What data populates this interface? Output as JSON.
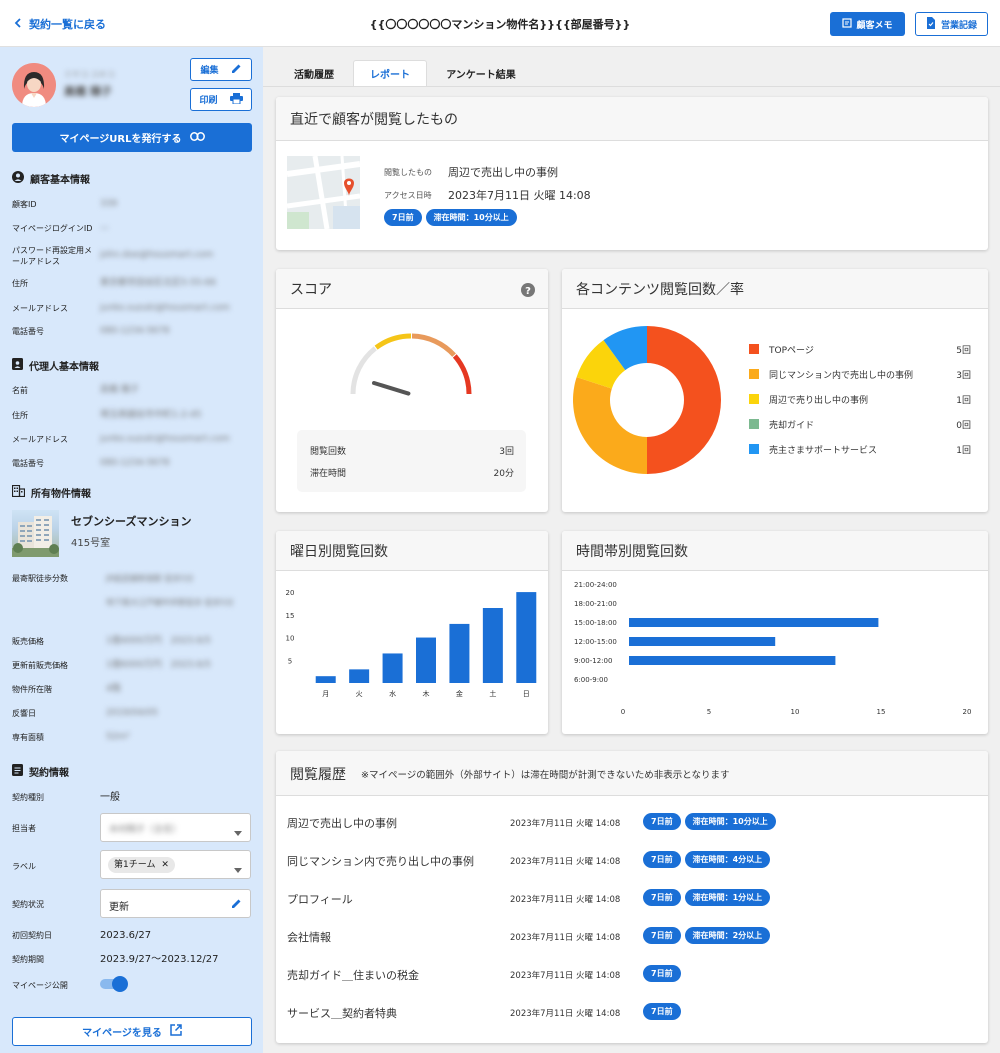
{
  "header": {
    "back_label": "契約一覧に戻る",
    "title": "{{〇〇〇〇〇〇マンション物件名}}{{部屋番号}}",
    "memo_label": "顧客メモ",
    "record_label": "営業記録"
  },
  "profile": {
    "name_kana": "ミヤコ ユキコ",
    "name": "高橋 陽子",
    "edit_label": "編集",
    "print_label": "印刷",
    "issue_url_label": "マイページURLを発行する"
  },
  "customer": {
    "title": "顧客基本情報",
    "rows": [
      {
        "label": "顧客ID",
        "value": "339"
      },
      {
        "label": "マイページログインID",
        "value": "—"
      },
      {
        "label": "パスワード再設定用メールアドレス",
        "value": "john.doe@housmart.com"
      },
      {
        "label": "住所",
        "value": "東京都世田谷区北区5-55-66"
      },
      {
        "label": "メールアドレス",
        "value": "junko.suzuki@housmart.com"
      },
      {
        "label": "電話番号",
        "value": "080-1234-5678"
      }
    ]
  },
  "agent": {
    "title": "代理人基本情報",
    "rows": [
      {
        "label": "名前",
        "value": "高橋 陽子"
      },
      {
        "label": "住所",
        "value": "埼玉県越谷市中町1-2-45"
      },
      {
        "label": "メールアドレス",
        "value": "junko.suzuki@housmart.com"
      },
      {
        "label": "電話番号",
        "value": "080-1234-5678"
      }
    ]
  },
  "property": {
    "title": "所有物件情報",
    "name": "セブンシーズマンション",
    "room": "415号室",
    "station_label": "最寄駅徒歩分数",
    "station_value_1": "JR総武線新宿駅 徒歩5分",
    "station_value_2": "地下鉄大江戸線中井駅徒歩 徒歩5分",
    "rows": [
      {
        "label": "販売価格",
        "value": "1億4000万円　2023.6/5"
      },
      {
        "label": "更新前販売価格",
        "value": "1億6000万円　2023.6/5"
      },
      {
        "label": "物件所在階",
        "value": "4階"
      },
      {
        "label": "反響日",
        "value": "2019/04/05"
      },
      {
        "label": "専有面積",
        "value": "52m²"
      }
    ]
  },
  "contract": {
    "title": "契約情報",
    "type_label": "契約種別",
    "type_value": "一般",
    "owner_label": "担当者",
    "owner_value": "木村翔子（主任）",
    "label_label": "ラベル",
    "label_chip": "第1チーム",
    "status_label": "契約状況",
    "status_value": "更新",
    "first_date_label": "初回契約日",
    "first_date_value": "2023.6/27",
    "period_label": "契約期間",
    "period_value": "2023.9/27〜2023.12/27",
    "public_label": "マイページ公開",
    "view_mypage_label": "マイページを見る"
  },
  "tabs": [
    "活動履歴",
    "レポート",
    "アンケート結果"
  ],
  "recent": {
    "title": "直近で顧客が閲覧したもの",
    "viewed_label": "閲覧したもの",
    "viewed_value": "周辺で売出し中の事例",
    "access_label": "アクセス日時",
    "access_value": "2023年7月11日 火曜 14:08",
    "badge_ago": "7日前",
    "badge_stay": "滞在時間：10分以上"
  },
  "score": {
    "title": "スコア",
    "gauge_value": 0.05,
    "rows": [
      {
        "label": "閲覧回数",
        "value": "3回"
      },
      {
        "label": "滞在時間",
        "value": "20分"
      }
    ]
  },
  "contents": {
    "title": "各コンテンツ閲覧回数／率",
    "items": [
      {
        "label": "TOPページ",
        "count": "5回",
        "color": "#f4511e"
      },
      {
        "label": "同じマンション内で売出し中の事例",
        "count": "3回",
        "color": "#fbaa1b"
      },
      {
        "label": "周辺で売り出し中の事例",
        "count": "1回",
        "color": "#fbd40b"
      },
      {
        "label": "売却ガイド",
        "count": "0回",
        "color": "#7cb990"
      },
      {
        "label": "売主さまサポートサービス",
        "count": "1回",
        "color": "#2196f3"
      }
    ]
  },
  "weekday": {
    "title": "曜日別閲覧回数"
  },
  "timeband": {
    "title": "時間帯別閲覧回数"
  },
  "chart_data": [
    {
      "type": "pie",
      "title": "各コンテンツ閲覧回数／率",
      "categories": [
        "TOPページ",
        "同じマンション内で売出し中の事例",
        "周辺で売り出し中の事例",
        "売却ガイド",
        "売主さまサポートサービス"
      ],
      "values": [
        5,
        3,
        1,
        0,
        1
      ]
    },
    {
      "type": "bar",
      "title": "曜日別閲覧回数",
      "categories": [
        "月",
        "火",
        "水",
        "木",
        "金",
        "土",
        "日"
      ],
      "values": [
        1.5,
        3,
        6.5,
        10,
        13,
        16.5,
        20
      ],
      "yticks": [
        5,
        10,
        15,
        20
      ],
      "ylim": [
        0,
        22
      ]
    },
    {
      "type": "bar",
      "orientation": "horizontal",
      "title": "時間帯別閲覧回数",
      "categories": [
        "21:00-24:00",
        "18:00-21:00",
        "15:00-18:00",
        "12:00-15:00",
        "9:00-12:00",
        "6:00-9:00"
      ],
      "values": [
        0,
        0,
        14.5,
        8.5,
        12,
        0
      ],
      "xticks": [
        0,
        5,
        10,
        15,
        20
      ],
      "xlim": [
        0,
        20
      ]
    }
  ],
  "history": {
    "title": "閲覧履歴",
    "note": "※マイページの範囲外（外部サイト）は滞在時間が計測できないため非表示となります",
    "rows": [
      {
        "name": "周辺で売出し中の事例",
        "date": "2023年7月11日 火曜 14:08",
        "ago": "7日前",
        "stay": "滞在時間：10分以上"
      },
      {
        "name": "同じマンション内で売り出し中の事例",
        "date": "2023年7月11日 火曜 14:08",
        "ago": "7日前",
        "stay": "滞在時間：4分以上"
      },
      {
        "name": "プロフィール",
        "date": "2023年7月11日 火曜 14:08",
        "ago": "7日前",
        "stay": "滞在時間：1分以上"
      },
      {
        "name": "会社情報",
        "date": "2023年7月11日 火曜 14:08",
        "ago": "7日前",
        "stay": "滞在時間：2分以上"
      },
      {
        "name": "売却ガイド＿住まいの税金",
        "date": "2023年7月11日 火曜 14:08",
        "ago": "7日前",
        "stay": ""
      },
      {
        "name": "サービス＿契約者特典",
        "date": "2023年7月11日 火曜 14:08",
        "ago": "7日前",
        "stay": ""
      }
    ]
  },
  "colors": {
    "primary": "#1a6fd6",
    "sidebar_bg": "#d8e8fb",
    "gauge_yellow": "#f5c518",
    "gauge_orange": "#e89a5c",
    "gauge_red": "#e53822"
  },
  "icons": [
    "chevron-left-icon",
    "memo-icon",
    "record-icon",
    "pencil-icon",
    "printer-icon",
    "link-icon",
    "user-circle-icon",
    "id-badge-icon",
    "building-icon",
    "document-icon",
    "close-icon",
    "caret-down-icon",
    "external-link-icon",
    "help-icon",
    "map-pin-icon"
  ]
}
